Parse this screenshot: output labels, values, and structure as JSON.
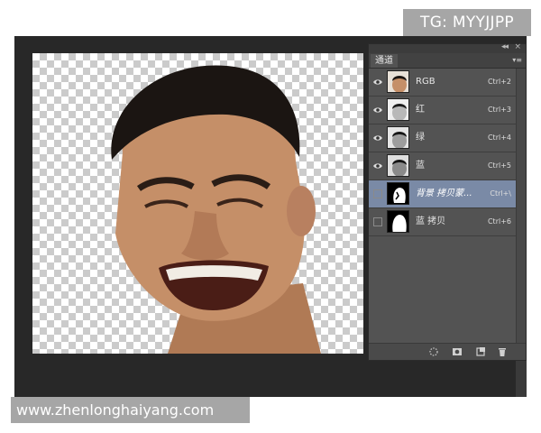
{
  "watermarks": {
    "top_right": "TG: MYYJJPP",
    "bottom_left": "www.zhenlonghaiyang.com"
  },
  "panel": {
    "tab_label": "通道",
    "collapse_glyph": "◂◂",
    "close_glyph": "×",
    "menu_glyph": "▾≡",
    "channels": [
      {
        "label": "RGB",
        "shortcut": "Ctrl+2",
        "visible": true,
        "selected": false,
        "thumb": "color-face-thumbnail"
      },
      {
        "label": "红",
        "shortcut": "Ctrl+3",
        "visible": true,
        "selected": false,
        "thumb": "gray-face-thumbnail"
      },
      {
        "label": "绿",
        "shortcut": "Ctrl+4",
        "visible": true,
        "selected": false,
        "thumb": "gray-face-thumbnail"
      },
      {
        "label": "蓝",
        "shortcut": "Ctrl+5",
        "visible": true,
        "selected": false,
        "thumb": "gray-face-thumbnail"
      },
      {
        "label": "背景 拷贝蒙...",
        "shortcut": "Ctrl+\\",
        "visible": false,
        "selected": true,
        "thumb": "mask-thumbnail"
      },
      {
        "label": "蓝 拷贝",
        "shortcut": "Ctrl+6",
        "visible": false,
        "selected": false,
        "thumb": "silhouette-thumbnail"
      }
    ],
    "bottom_icons": [
      "dotted-circle-icon",
      "save-selection-icon",
      "new-channel-icon",
      "trash-icon"
    ]
  },
  "colors": {
    "workspace": "#282828",
    "panel": "#535353",
    "selected_row": "#7a8aa6",
    "watermark_bg": "#a6a6a6"
  }
}
